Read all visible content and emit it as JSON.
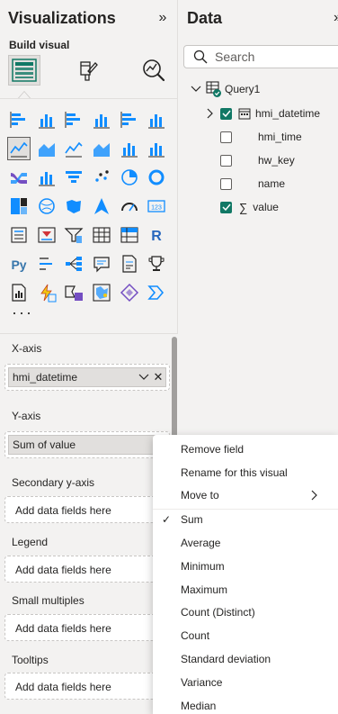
{
  "viz_pane": {
    "title": "Visualizations",
    "collapse_glyph": "»",
    "build_label": "Build visual",
    "tabs": [
      {
        "name": "build-visual-tab",
        "icon": "fields-grid-icon",
        "active": true
      },
      {
        "name": "format-visual-tab",
        "icon": "paint-brush-icon",
        "active": false
      },
      {
        "name": "analytics-tab",
        "icon": "analytics-magnifier-icon",
        "active": false
      }
    ],
    "more_label": "···",
    "visual_icons": [
      "stacked-bar-chart-icon",
      "stacked-column-chart-icon",
      "clustered-bar-chart-icon",
      "clustered-column-chart-icon",
      "100-stacked-bar-chart-icon",
      "100-stacked-column-chart-icon",
      "line-chart-icon",
      "area-chart-icon",
      "stacked-area-chart-icon",
      "100-stacked-area-chart-icon",
      "line-and-stacked-column-icon",
      "line-and-clustered-column-icon",
      "ribbon-chart-icon",
      "waterfall-chart-icon",
      "funnel-chart-icon",
      "scatter-chart-icon",
      "pie-chart-icon",
      "donut-chart-icon",
      "treemap-icon",
      "map-icon",
      "filled-map-icon",
      "azure-map-icon",
      "gauge-icon",
      "card-icon",
      "multi-row-card-icon",
      "kpi-icon",
      "slicer-icon",
      "table-icon",
      "matrix-icon",
      "r-script-visual-icon",
      "python-visual-icon",
      "key-influencers-icon",
      "decomposition-tree-icon",
      "qa-visual-icon",
      "smart-narrative-icon",
      "goals-trophy-icon",
      "paginated-report-icon",
      "power-automate-icon",
      "power-apps-icon",
      "shape-map-icon",
      "diamond-visual-icon",
      "chevron-visual-icon"
    ],
    "selected_icon_index": 6,
    "wells": {
      "x_axis": {
        "label": "X-axis",
        "field": "hmi_datetime"
      },
      "y_axis": {
        "label": "Y-axis",
        "field": "Sum of value"
      },
      "secondary_y": {
        "label": "Secondary y-axis",
        "placeholder": "Add data fields here"
      },
      "legend": {
        "label": "Legend",
        "placeholder": "Add data fields here"
      },
      "small_multiples": {
        "label": "Small multiples",
        "placeholder": "Add data fields here"
      },
      "tooltips": {
        "label": "Tooltips",
        "placeholder": "Add data fields here"
      }
    }
  },
  "data_pane": {
    "title": "Data",
    "collapse_glyph": "»",
    "search_placeholder": "Search",
    "table": {
      "name": "Query1",
      "expanded": true
    },
    "fields": [
      {
        "name": "hmi_datetime",
        "checked": true,
        "type": "date-hierarchy",
        "expandable": true
      },
      {
        "name": "hmi_time",
        "checked": false,
        "type": "text",
        "expandable": false
      },
      {
        "name": "hw_key",
        "checked": false,
        "type": "text",
        "expandable": false
      },
      {
        "name": "name",
        "checked": false,
        "type": "text",
        "expandable": false
      },
      {
        "name": "value",
        "checked": true,
        "type": "sigma",
        "expandable": false
      }
    ]
  },
  "context_menu": {
    "items": [
      {
        "label": "Remove field"
      },
      {
        "label": "Rename for this visual"
      },
      {
        "label": "Move to",
        "submenu": true
      }
    ],
    "aggregations": [
      {
        "label": "Sum",
        "checked": true
      },
      {
        "label": "Average",
        "checked": false
      },
      {
        "label": "Minimum",
        "checked": false
      },
      {
        "label": "Maximum",
        "checked": false
      },
      {
        "label": "Count (Distinct)",
        "checked": false
      },
      {
        "label": "Count",
        "checked": false
      },
      {
        "label": "Standard deviation",
        "checked": false
      },
      {
        "label": "Variance",
        "checked": false
      },
      {
        "label": "Median",
        "checked": false
      }
    ]
  },
  "colors": {
    "accent_green": "#117865",
    "power_bi_yellow": "#f2c811",
    "r_blue": "#2767bd",
    "python_blue": "#3776ab",
    "chart_blue": "#118dff",
    "chart_purple": "#744ec2"
  }
}
